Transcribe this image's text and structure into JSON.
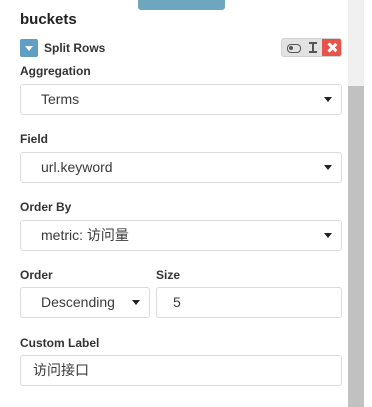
{
  "panel": {
    "heading": "buckets"
  },
  "aggregation_block": {
    "title": "Split Rows",
    "controls": [
      "toggle-icon",
      "move-icon",
      "remove-icon"
    ],
    "colors": {
      "collapse": "#5f9fc4",
      "remove": "#e5534b",
      "tab": "#6ea6be"
    }
  },
  "form": {
    "aggregation": {
      "label": "Aggregation",
      "value": "Terms"
    },
    "field": {
      "label": "Field",
      "value": "url.keyword"
    },
    "order_by": {
      "label": "Order By",
      "value": "metric: 访问量"
    },
    "order": {
      "label": "Order",
      "value": "Descending"
    },
    "size": {
      "label": "Size",
      "value": "5"
    },
    "custom_label": {
      "label": "Custom Label",
      "value": "访问接口"
    }
  }
}
